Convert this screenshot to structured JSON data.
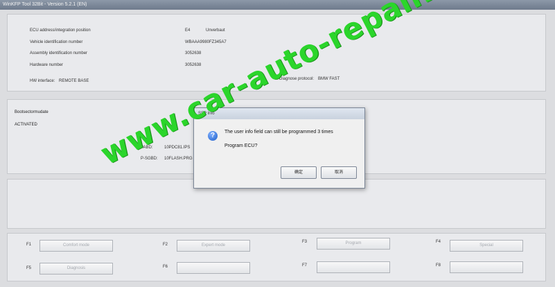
{
  "window": {
    "title": "WinKFP Tool 32Bit - Version 5.2.1 (EN)"
  },
  "info": {
    "rows": [
      {
        "label": "ECU address/integration position",
        "value": "E4",
        "extra": "Unverbaut"
      },
      {
        "label": "Vehicle identification number",
        "value": "WBAAA9980FZ345A7",
        "extra": ""
      },
      {
        "label": "Assembly identification number",
        "value": "3052638",
        "extra": ""
      },
      {
        "label": "Hardware number",
        "value": "3052638",
        "extra": ""
      }
    ],
    "hw_interface_label": "HW interface:",
    "hw_interface_value": "REMOTE BASE",
    "diag_protocol_label": "Diagnose protocol:",
    "diag_protocol_value": "BMW FAST"
  },
  "status": {
    "title": "Bootsectormudate",
    "value": "ACTIVATED",
    "pabd_label": "PABD:",
    "pabd_value": "10PDC81.IPS",
    "psgbd_label": "P-SGBD:",
    "psgbd_value": "10FLASH.PRG"
  },
  "dialog": {
    "title": "SSP Info",
    "message_line1": "The user info field can still be programmed 3 times",
    "message_line2": "Program ECU?",
    "ok_label": "确定",
    "cancel_label": "取消",
    "icon": "question-icon"
  },
  "function_keys": [
    {
      "key": "F1",
      "label": "Comfort mode"
    },
    {
      "key": "F2",
      "label": "Expert mode"
    },
    {
      "key": "F3",
      "label": "Program"
    },
    {
      "key": "F4",
      "label": "Special"
    },
    {
      "key": "F5",
      "label": "Diagnosis"
    },
    {
      "key": "F6",
      "label": ""
    },
    {
      "key": "F7",
      "label": ""
    },
    {
      "key": "F8",
      "label": ""
    }
  ],
  "watermark": "www.car-auto-repair.com",
  "colors": {
    "watermark": "#2bd52b",
    "dialog_title": "#c9d2de",
    "background": "#dcdde0"
  }
}
